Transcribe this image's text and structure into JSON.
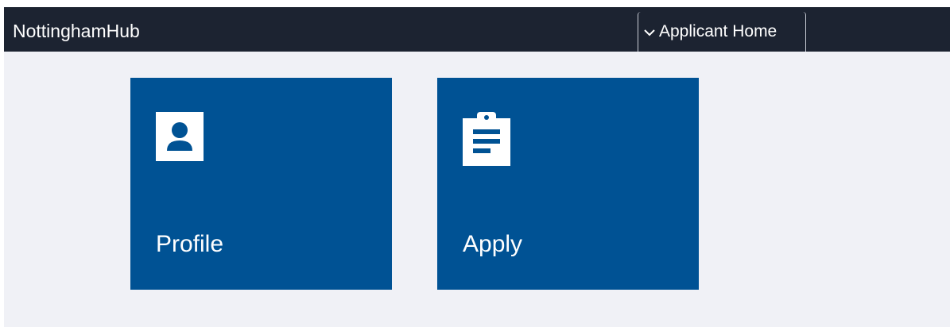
{
  "header": {
    "brand": "NottinghamHub",
    "nav_selector": {
      "label": "Applicant Home",
      "icon": "chevron-down-icon"
    }
  },
  "tiles": [
    {
      "label": "Profile",
      "icon": "person-icon"
    },
    {
      "label": "Apply",
      "icon": "clipboard-icon"
    }
  ],
  "colors": {
    "header_bg": "#1c2331",
    "page_bg": "#f0f1f6",
    "tile_bg": "#005294",
    "text_light": "#ffffff"
  }
}
